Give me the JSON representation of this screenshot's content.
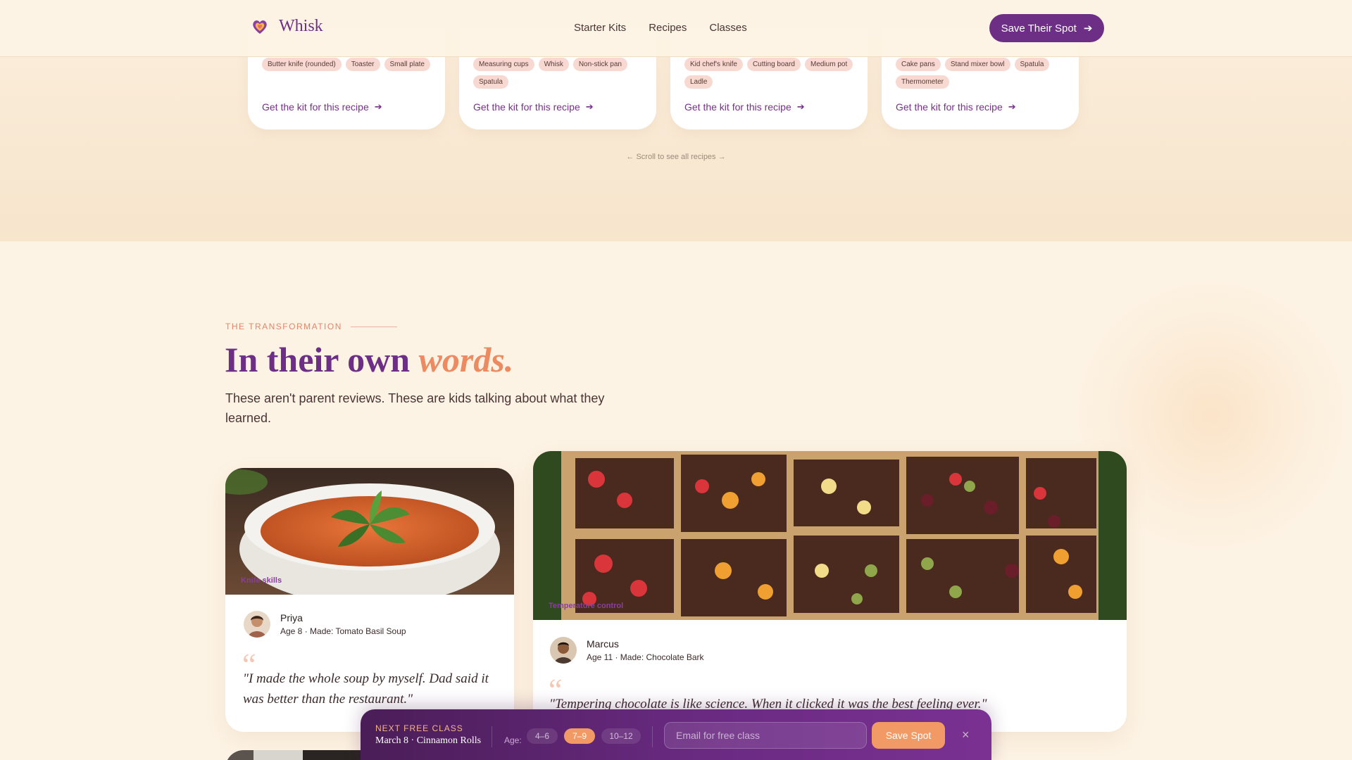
{
  "header": {
    "brand": "Whisk",
    "nav": [
      "Starter Kits",
      "Recipes",
      "Classes"
    ],
    "cta": "Save Their Spot"
  },
  "recipes": {
    "cards": [
      {
        "tags": [
          "Butter knife (rounded)",
          "Toaster",
          "Small plate"
        ],
        "link": "Get the kit for this recipe"
      },
      {
        "tags": [
          "Measuring cups",
          "Whisk",
          "Non-stick pan",
          "Spatula"
        ],
        "link": "Get the kit for this recipe"
      },
      {
        "tags": [
          "Kid chef's knife",
          "Cutting board",
          "Medium pot",
          "Ladle"
        ],
        "link": "Get the kit for this recipe"
      },
      {
        "tags": [
          "Cake pans",
          "Stand mixer bowl",
          "Spatula",
          "Thermometer"
        ],
        "link": "Get the kit for this recipe"
      }
    ],
    "scroll_hint": "← Scroll to see all recipes →"
  },
  "transformation": {
    "eyebrow": "THE TRANSFORMATION",
    "headline": "In their own",
    "headline_accent": "words.",
    "sub": "These aren't parent reviews. These are kids talking about what they learned."
  },
  "testimonials": [
    {
      "name": "Priya",
      "meta": "Age 8 · Made: Tomato Basil Soup",
      "image_caption": "Knife skills",
      "quote": "\"I made the whole soup by myself. Dad said it was better than the restaurant.\""
    },
    {
      "name": "Marcus",
      "meta": "Age 11 · Made: Chocolate Bark",
      "image_caption": "Temperature control",
      "quote": "\"Tempering chocolate is like science. When it clicked it was the best feeling ever.\""
    }
  ],
  "sticky_bar": {
    "label": "NEXT FREE CLASS",
    "info": "March 8 · Cinnamon Rolls",
    "age_label": "Age:",
    "ages": [
      "4–6",
      "7–9",
      "10–12"
    ],
    "selected_age": "7–9",
    "email_placeholder": "Email for free class",
    "submit": "Save Spot",
    "close": "×"
  },
  "colors": {
    "brand_purple": "#6d2f86",
    "accent_orange": "#ec8b62",
    "cream": "#fdf3e4",
    "tag_pink": "#f7d9d2"
  },
  "icons": [
    "heart-whisk-logo-icon",
    "arrow-right-icon",
    "quote-icon",
    "close-icon"
  ]
}
